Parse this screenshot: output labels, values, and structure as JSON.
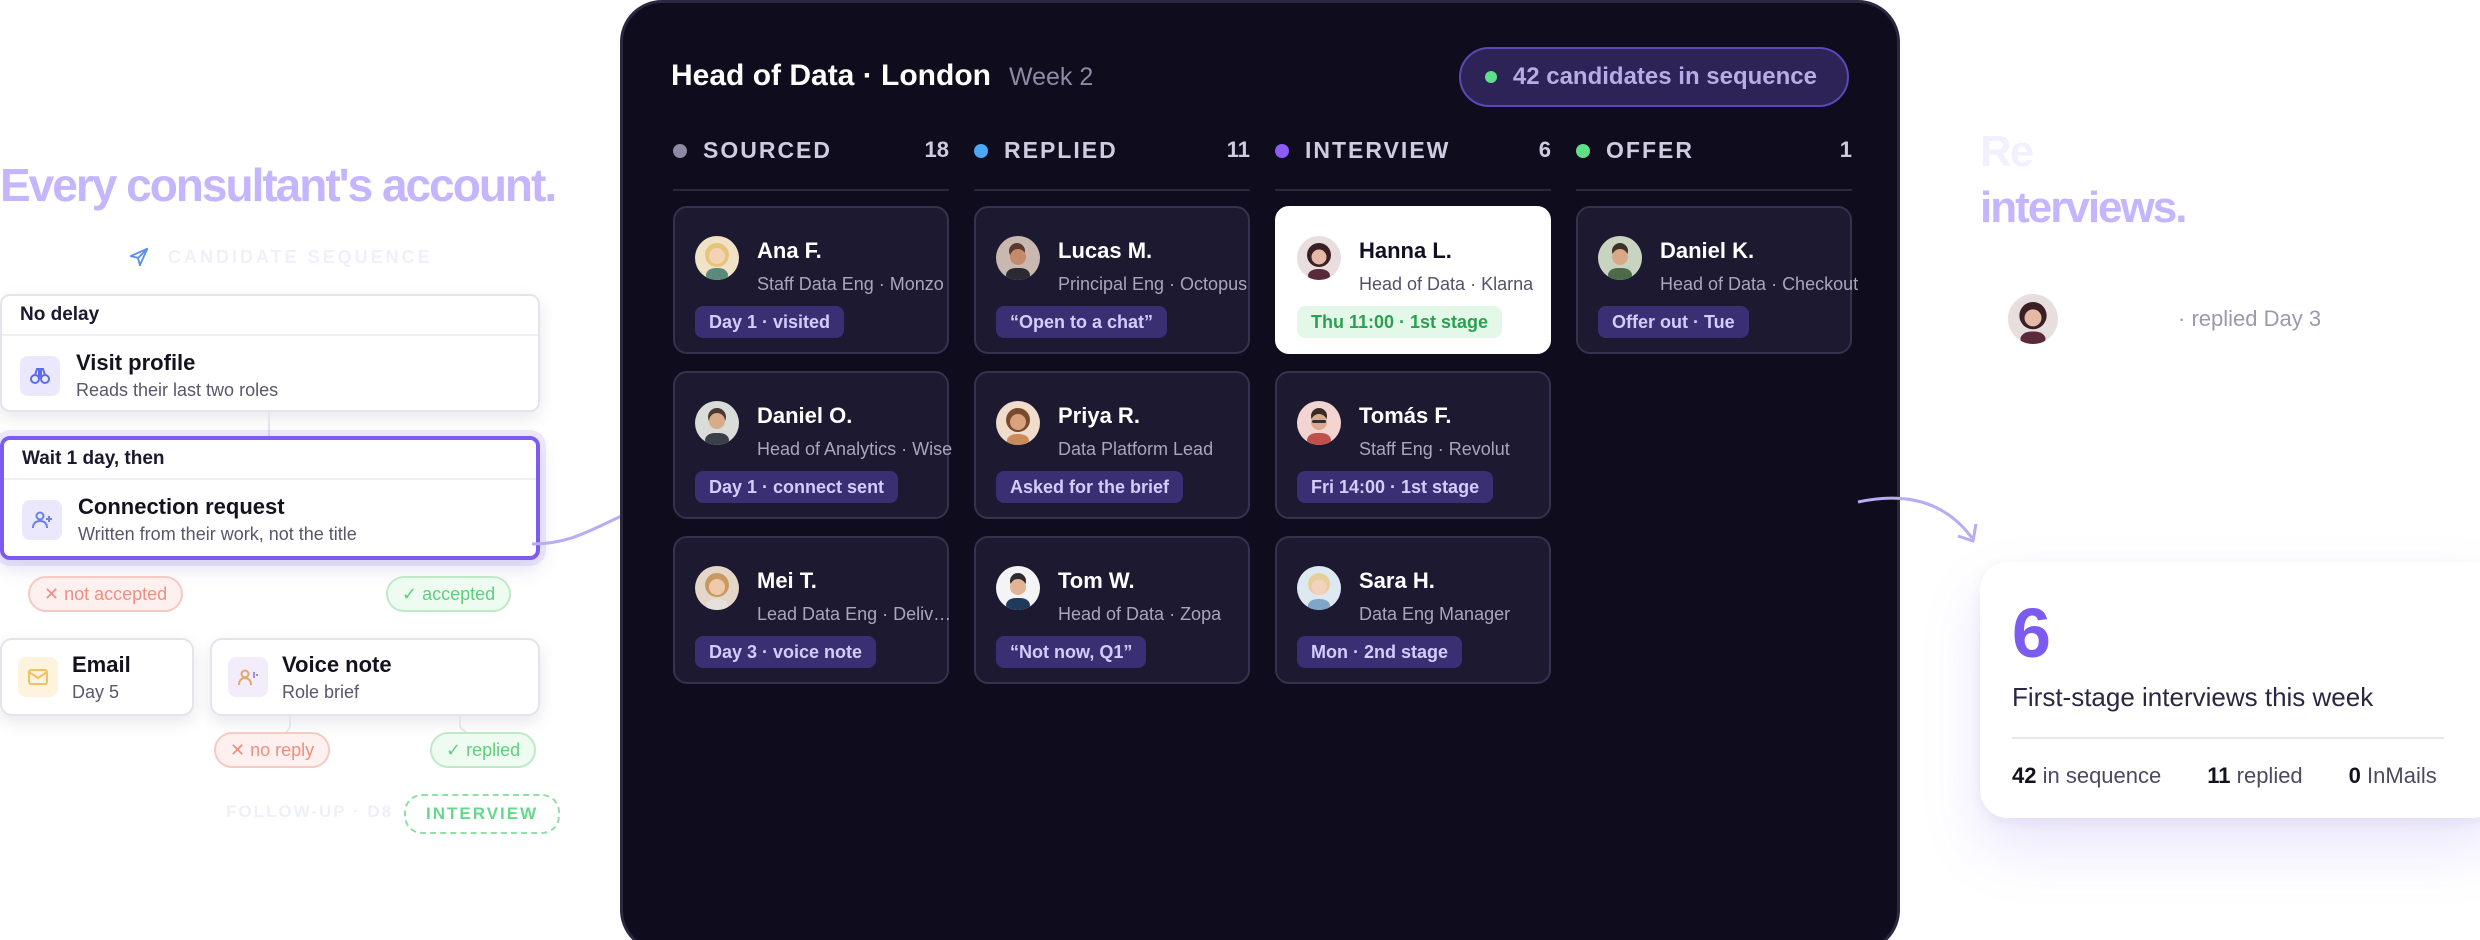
{
  "left": {
    "headline": "Every consultant's account.",
    "sequence_label": "CANDIDATE SEQUENCE",
    "step1": {
      "delay": "No delay",
      "title": "Visit profile",
      "subtitle": "Reads their last two roles",
      "icon": "binoculars-icon"
    },
    "step2": {
      "delay": "Wait 1 day, then",
      "title": "Connection request",
      "subtitle": "Written from their work, not the title",
      "icon": "add-person-icon"
    },
    "branch1": {
      "negative": "✕ not accepted",
      "positive": "✓ accepted"
    },
    "email": {
      "title": "Email",
      "subtitle": "Day 5",
      "icon": "envelope-icon"
    },
    "voice": {
      "title": "Voice note",
      "subtitle": "Role brief",
      "icon": "voice-note-icon"
    },
    "branch2": {
      "negative": "✕ no reply",
      "positive": "✓ replied"
    },
    "followup": "FOLLOW-UP · D8",
    "interview": "INTERVIEW"
  },
  "board": {
    "title": "Head of Data · London",
    "week": "Week 2",
    "sequence_pill": "42 candidates in sequence",
    "columns": [
      {
        "label": "SOURCED",
        "count": "18",
        "dot": "#8e8aa3",
        "cards": [
          {
            "name": "Ana F.",
            "role": "Staff Data Eng · Monzo",
            "tag": "Day 1 · visited"
          },
          {
            "name": "Daniel O.",
            "role": "Head of Analytics · Wise",
            "tag": "Day 1 · connect sent"
          },
          {
            "name": "Mei T.",
            "role": "Lead Data Eng · Deliveroo",
            "tag": "Day 3 · voice note"
          }
        ]
      },
      {
        "label": "REPLIED",
        "count": "11",
        "dot": "#4aa8f5",
        "cards": [
          {
            "name": "Lucas M.",
            "role": "Principal Eng · Octopus",
            "tag": "“Open to a chat”"
          },
          {
            "name": "Priya R.",
            "role": "Data Platform Lead",
            "tag": "Asked for the brief"
          },
          {
            "name": "Tom W.",
            "role": "Head of Data · Zopa",
            "tag": "“Not now, Q1”"
          }
        ]
      },
      {
        "label": "INTERVIEW",
        "count": "6",
        "dot": "#8b5cf6",
        "cards": [
          {
            "name": "Hanna L.",
            "role": "Head of Data · Klarna",
            "tag": "Thu 11:00 · 1st stage"
          },
          {
            "name": "Tomás F.",
            "role": "Staff Eng · Revolut",
            "tag": "Fri 14:00 · 1st stage"
          },
          {
            "name": "Sara H.",
            "role": "Data Eng Manager",
            "tag": "Mon · 2nd stage"
          }
        ]
      },
      {
        "label": "OFFER",
        "count": "1",
        "dot": "#5ee08a",
        "cards": [
          {
            "name": "Daniel K.",
            "role": "Head of Data · Checkout",
            "tag": "Offer out · Tue"
          }
        ]
      }
    ]
  },
  "right": {
    "headline_line1": "Re",
    "headline_line2": "interviews.",
    "reply_text": "· replied Day 3",
    "stat": {
      "number": "6",
      "label": "First-stage interviews this week",
      "m1_num": "42",
      "m1_label": " in sequence",
      "m2_num": "11",
      "m2_label": " replied",
      "m3_num": "0",
      "m3_label": " InMails"
    }
  }
}
